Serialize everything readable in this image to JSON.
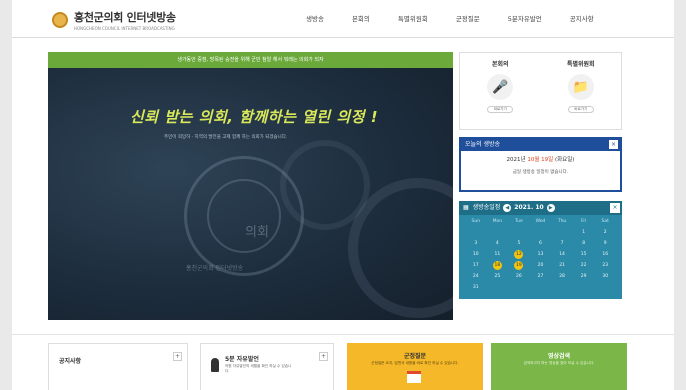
{
  "header": {
    "logo_title": "홍천군의회 인터넷방송",
    "logo_sub": "HONGCHEON COUNCIL INTERNET BROADCASTING",
    "nav": [
      "생방송",
      "본회의",
      "특별위원회",
      "군정질문",
      "5분자유발언",
      "공지사항"
    ]
  },
  "video": {
    "banner": "생가동안 중점, 방목된 숭전을 위해 군민 참알 해서 뭐래는 의회가 되자",
    "slogan": "신뢰 받는 의회, 함께하는 열린 의정 !",
    "slogan_sub": "주민이 희망하 · 지역의 발전을 고제 함께 하는 의회가 되겠습니다.",
    "seal_text": "의회",
    "watermark": "홍천군의회 인터넷방송"
  },
  "quick": [
    {
      "label": "본회의",
      "button": "바로가기"
    },
    {
      "label": "특별위원회",
      "button": "바로가기"
    }
  ],
  "today": {
    "title": "오늘의 생방송",
    "date_prefix": "2021년",
    "date_highlight": "10월 19일",
    "date_suffix": "(화요일)",
    "message": "금일 생방송 일정이 없습니다.",
    "close": "×"
  },
  "calendar": {
    "title": "생방송일정",
    "year_month": "2021. 10",
    "close": "×",
    "weekdays": [
      "Sun",
      "Mon",
      "Tue",
      "Wed",
      "Thu",
      "Fri",
      "Sat"
    ],
    "days": [
      "",
      "",
      "",
      "",
      "",
      "1",
      "2",
      "3",
      "4",
      "5",
      "6",
      "7",
      "8",
      "9",
      "10",
      "11",
      "12",
      "13",
      "14",
      "15",
      "16",
      "17",
      "18",
      "19",
      "20",
      "21",
      "22",
      "23",
      "24",
      "25",
      "26",
      "27",
      "28",
      "29",
      "30",
      "31",
      "",
      "",
      "",
      "",
      "",
      ""
    ],
    "marked_days": [
      "12",
      "18",
      "19"
    ]
  },
  "bottom": {
    "notice_title": "공지사항",
    "speech_title": "5분 자유발언",
    "speech_sub": "의원 자유발언의 세월을 확인 하실 수 있습니다.",
    "schedule_title": "군정질문",
    "schedule_sub": "군정질문 요지, 답변서 내용을 바로 확인 하실 수 있습니다.",
    "search_title": "영상검색",
    "search_sub": "검색하고자 하는 영상을 찾아 보실 수 있습니다.",
    "plus": "+"
  },
  "colors": {
    "primary_blue": "#1f4f9a",
    "calendar_teal": "#2b8aa8",
    "banner_green": "#6aa93a",
    "schedule_yellow": "#f4b829",
    "search_green": "#7ab648"
  }
}
